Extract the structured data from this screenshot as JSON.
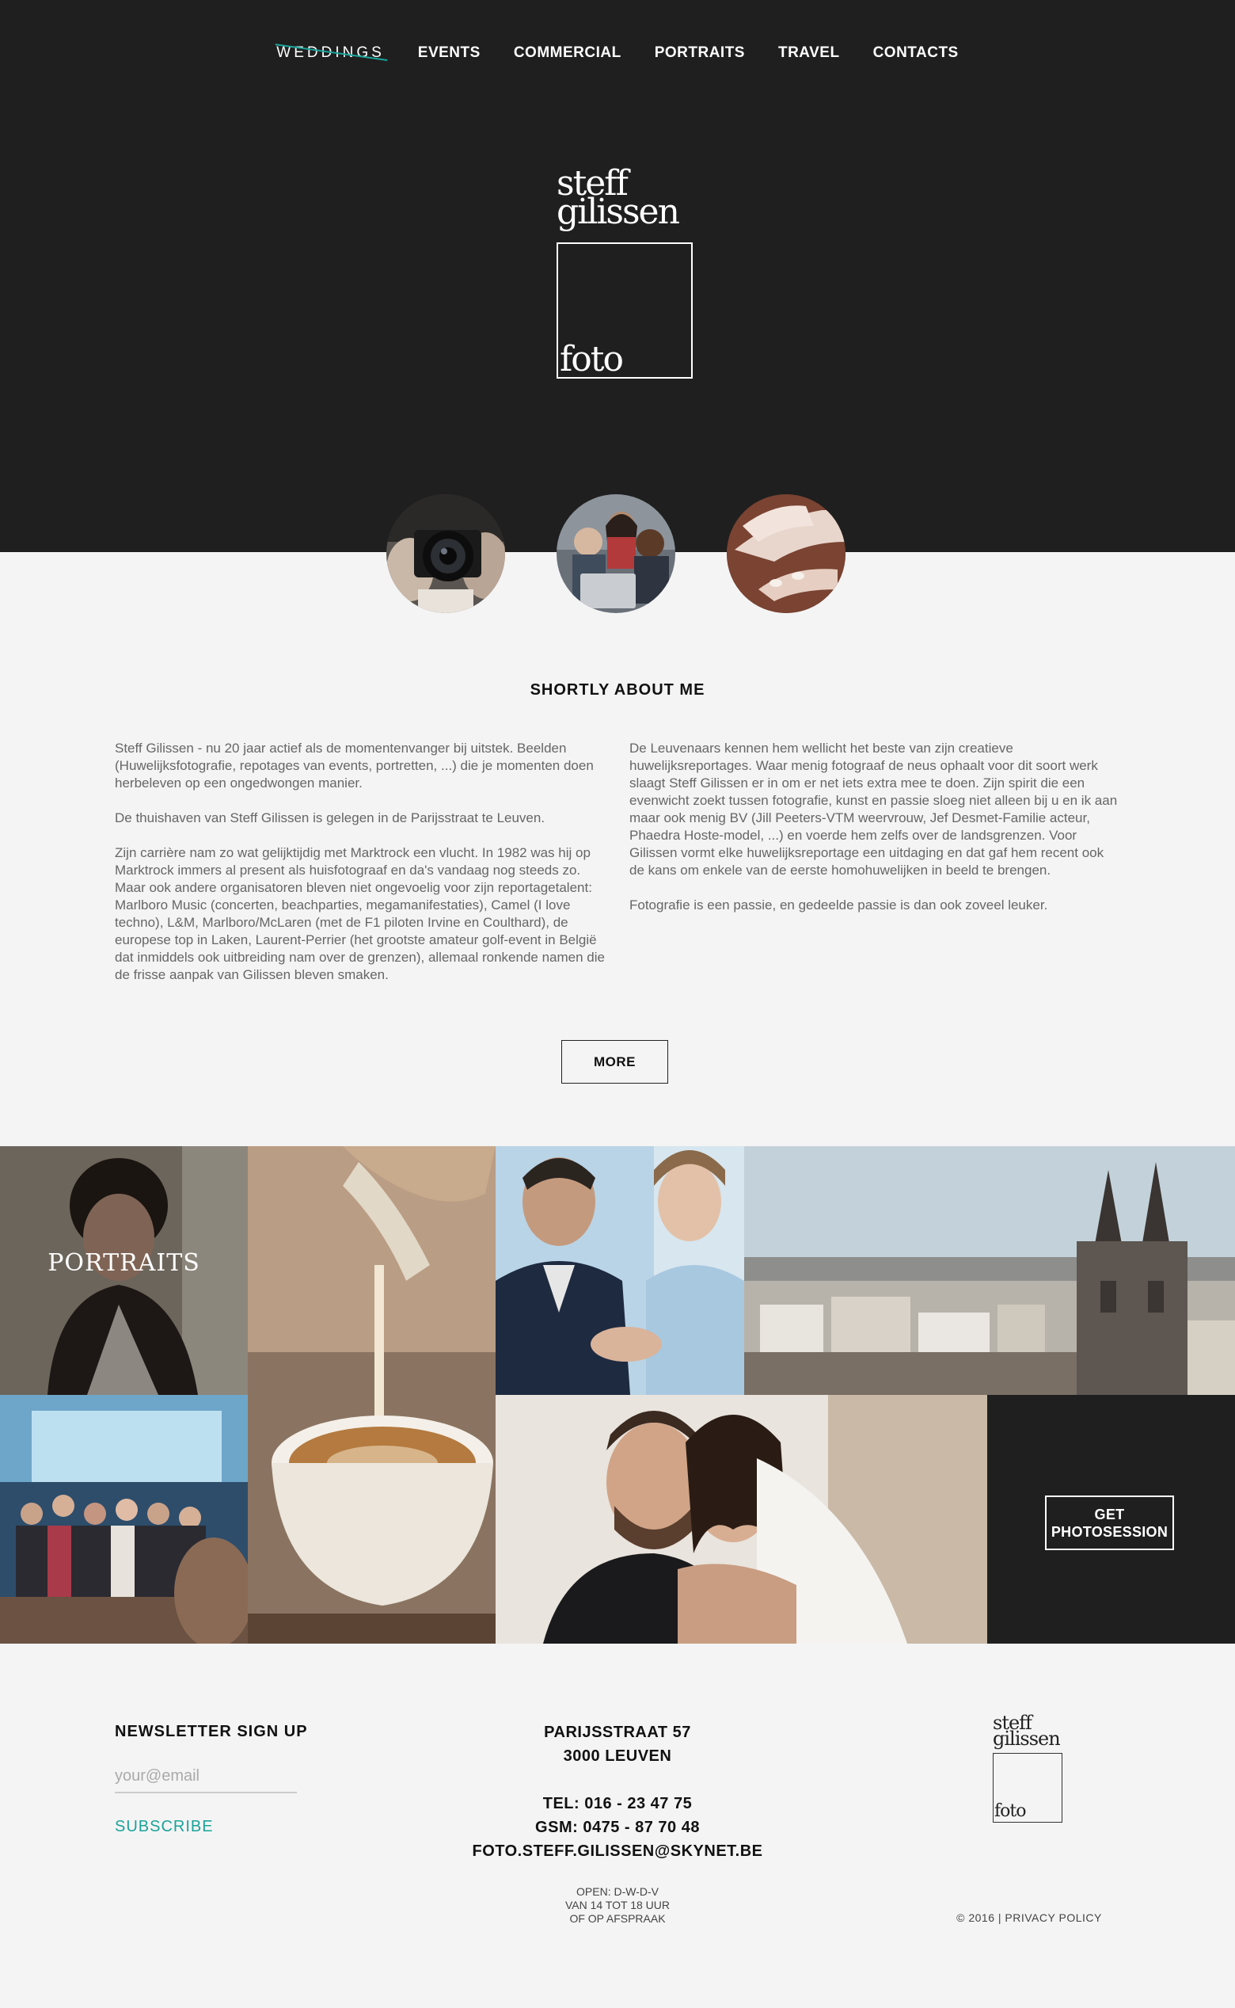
{
  "nav": {
    "items": [
      "WEDDINGS",
      "EVENTS",
      "COMMERCIAL",
      "PORTRAITS",
      "TRAVEL",
      "CONTACTS"
    ],
    "active": "WEDDINGS"
  },
  "logo": {
    "line1": "steff",
    "line2": "gilissen",
    "line3": "foto"
  },
  "about": {
    "title": "SHORTLY ABOUT ME",
    "left": [
      "Steff Gilissen - nu 20 jaar actief als de momentenvanger bij uitstek. Beelden (Huwelijksfotografie, repotages van events, portretten, ...) die je momenten doen herbeleven op een ongedwongen manier.",
      "De thuishaven van Steff Gilissen is gelegen in de Parijsstraat te Leuven.",
      "Zijn carrière nam zo wat gelijktijdig met Marktrock een vlucht. In 1982 was hij op Marktrock immers al present als huisfotograaf en da's vandaag nog steeds zo. Maar ook andere organisatoren bleven niet ongevoelig voor zijn reportagetalent: Marlboro Music (concerten, beachparties, megamanifestaties), Camel (I love techno), L&M, Marlboro/McLaren (met de F1 piloten Irvine en Coulthard), de europese top in Laken, Laurent-Perrier (het grootste amateur golf-event in België dat inmiddels ook uitbreiding nam over de grenzen), allemaal ronkende namen die de frisse aanpak van Gilissen bleven smaken."
    ],
    "right": [
      "De Leuvenaars kennen hem wellicht het beste van zijn creatieve huwelijksreportages. Waar menig fotograaf de neus ophaalt voor dit soort werk slaagt Steff Gilissen er in om er net iets extra mee te doen. Zijn spirit die een evenwicht zoekt tussen fotografie, kunst en passie sloeg niet alleen bij u en ik aan maar ook menig BV (Jill Peeters-VTM weervrouw, Jef Desmet-Familie acteur, Phaedra Hoste-model, ...) en voerde hem zelfs over de landsgrenzen. Voor Gilissen vormt elke huwelijksreportage een uitdaging en dat gaf hem recent ook de kans om enkele van de eerste homohuwelijken in beeld te brengen.",
      "Fotografie is een passie, en gedeelde passie is dan ook zoveel leuker."
    ],
    "more_label": "MORE"
  },
  "gallery": {
    "portrait_label": "PORTRAITS",
    "cta_line1": "GET",
    "cta_line2": "PHOTOSESSION"
  },
  "footer": {
    "newsletter_title": "NEWSLETTER SIGN UP",
    "email_placeholder": "your@email",
    "subscribe_label": "SUBSCRIBE",
    "address1": "PARIJSSTRAAT 57",
    "address2": "3000 LEUVEN",
    "tel": "TEL: 016 - 23 47 75",
    "gsm": "GSM: 0475 - 87 70 48",
    "email": "FOTO.STEFF.GILISSEN@SKYNET.BE",
    "hours1": "OPEN: D-W-D-V",
    "hours2": "VAN 14 TOT 18 UUR",
    "hours3": "OF OP AFSPRAAK",
    "copyright": "© 2016 |",
    "privacy": "PRIVACY POLICY"
  },
  "colors": {
    "dark": "#1f1f1f",
    "accent": "#1aa39a",
    "light": "#f4f4f4"
  }
}
